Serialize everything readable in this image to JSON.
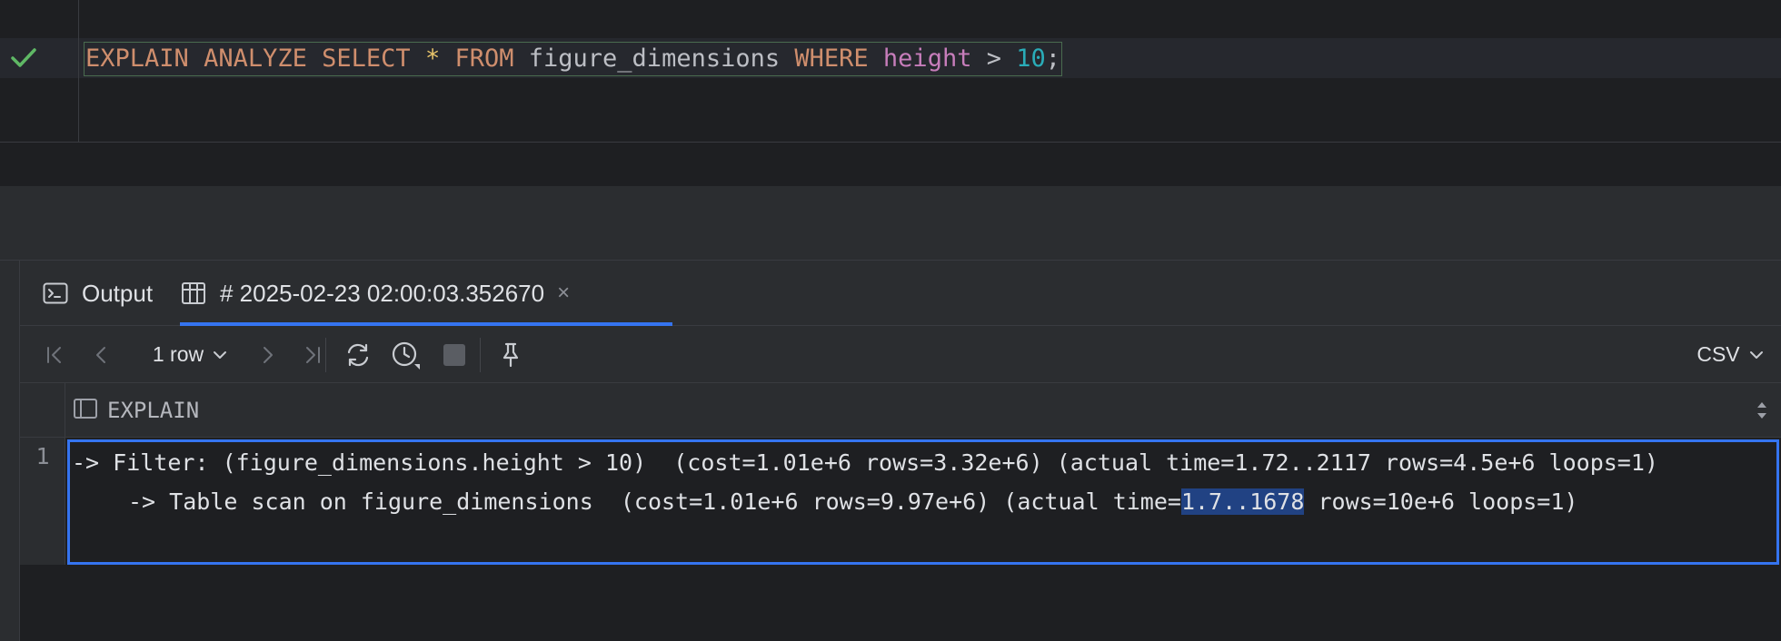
{
  "editor": {
    "status_icon": "checkmark-icon",
    "query": {
      "kw1": "EXPLAIN",
      "kw2": "ANALYZE",
      "kw3": "SELECT",
      "star": "*",
      "kw4": "FROM",
      "table": "figure_dimensions",
      "kw5": "WHERE",
      "column": "height",
      "operator": ">",
      "value": "10",
      "terminator": ";"
    }
  },
  "tabs": {
    "output": {
      "label": "Output",
      "icon": "console-icon"
    },
    "result": {
      "label": "# 2025-02-23 02:00:03.352670",
      "icon": "table-icon",
      "close": "×"
    }
  },
  "toolbar": {
    "first": "first-page-icon",
    "prev": "prev-page-icon",
    "rows_label": "1 row",
    "next": "next-page-icon",
    "last": "last-page-icon",
    "reload": "reload-icon",
    "history": "history-icon",
    "stop": "stop-icon",
    "pin": "pin-icon",
    "export_format": "CSV"
  },
  "grid": {
    "column_header": "EXPLAIN",
    "rows": [
      {
        "number": "1",
        "line1": "-> Filter: (figure_dimensions.height > 10)  (cost=1.01e+6 rows=3.32e+6) (actual time=1.72..2117 rows=4.5e+6 loops=1)",
        "line2_before": "-> Table scan on figure_dimensions  (cost=1.01e+6 rows=9.97e+6) (actual time=",
        "line2_selected": "1.7..1678",
        "line2_after": " rows=10e+6 loops=1)"
      }
    ]
  },
  "colors": {
    "accent": "#3574f0",
    "keyword": "#cf8e6d",
    "column": "#c77dbb",
    "number": "#2aacb8",
    "success": "#5fb865"
  }
}
